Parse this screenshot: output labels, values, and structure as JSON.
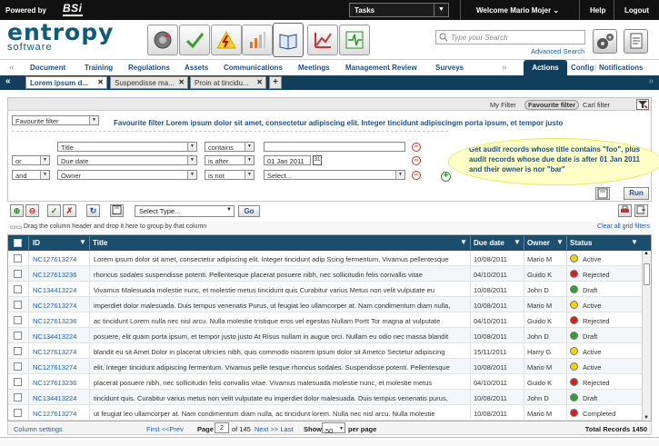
{
  "topbar": {
    "powered_by": "Powered by",
    "logo": "BSi",
    "tasks": "Tasks",
    "welcome": "Welcome  Mario Mojer",
    "help": "Help",
    "logout": "Logout"
  },
  "brand": {
    "name": "entropy",
    "sub": "software"
  },
  "toolbar_icons": [
    "gauge-icon",
    "check-icon",
    "warning-icon",
    "bar-chart-icon",
    "book-icon",
    "trend-chart-icon",
    "network-icon"
  ],
  "search": {
    "placeholder": "Type your Search",
    "advanced": "Advanced Search"
  },
  "nav": {
    "items": [
      "Document",
      "Training",
      "Regulations",
      "Assets",
      "Communications",
      "Meetings",
      "Management Review",
      "Surveys"
    ],
    "actions": "Actions",
    "config": "Config",
    "notifications": "Notifications"
  },
  "tabs": [
    {
      "label": "Lorem ipsum d..."
    },
    {
      "label": "Suspendisse ma..."
    },
    {
      "label": "Proin at tincidu..."
    }
  ],
  "filter": {
    "header_my": "My Filter",
    "header_fav": "Favourite filter",
    "header_carl": "Carl filter",
    "fav_select": "Favourite filter",
    "title": "Favourite filter Lorem ipsum dolor sit amet, consectetur adipiscing elit. Integer tincidunt adipiscingm porta ipsum, et tempor justo",
    "rows": [
      {
        "conj": "",
        "field": "Title",
        "op": "contains",
        "value": ""
      },
      {
        "conj": "or",
        "field": "Due date",
        "op": "is after",
        "value": "01 Jan 2011"
      },
      {
        "conj": "and",
        "field": "Owner",
        "op": "is not",
        "value": "Select..."
      }
    ],
    "note": "Get audit records whose title contains \"foo\", plus audit records whose due date is after 01 Jan 2011 and their owner is nor \"bar\"",
    "run": "Run"
  },
  "gridtools": {
    "type_placeholder": "Select Type...",
    "go": "Go"
  },
  "group_text": "Drag the column header and drop it here to group by that column",
  "clear_filters": "Clear all grid filters",
  "columns": {
    "id": "ID",
    "title": "Title",
    "due": "Due date",
    "owner": "Owner",
    "status": "Status"
  },
  "rows": [
    {
      "id": "NC127613274",
      "title": "Lorem ipsum dolor sit amet, consectetur adipiscing elit. Integer tincidunt adip Scing fermentum. Vivamus pellentesque",
      "due": "10/08/2011",
      "owner": "Mario M",
      "status": "Active"
    },
    {
      "id": "NC127613236",
      "title": "rhoncus sodales suspendisse potenti. Pellentesque placerat posuere nibh, nec sollicitudin felis convallis vitae",
      "due": "04/10/2011",
      "owner": "Guido K",
      "status": "Rejected"
    },
    {
      "id": "NC134413224",
      "title": "Vivamus Malesuada molestie nunc, et molestie metus tincidunt quis Curabitur  varius Metus non velit vulputate eu",
      "due": "10/08/2011",
      "owner": "John D",
      "status": "Draft"
    },
    {
      "id": "NC127613274",
      "title": "imperdiet dolor malesuada. Duis tempus venenatis Purus, ut feugiat leo ullamcorper at. Nam condimentum diam nulla,",
      "due": "10/08/2011",
      "owner": "Mario M",
      "status": "Active"
    },
    {
      "id": "NC127613236",
      "title": "ac tincidunt Lorem nulla nec nisl arcu. Nulla molestie tristique eros vel egestas Nullam Portt Tor magna at vulputate",
      "due": "04/10/2011",
      "owner": "Guido K",
      "status": "Rejected"
    },
    {
      "id": "NC134413224",
      "title": "posuere, elit quam porta ipsum, et tempor justo justo At Risus nullam in augue orci. Nullam eu odio nec massa blandit",
      "due": "10/08/2011",
      "owner": "John D",
      "status": "Draft"
    },
    {
      "id": "NC127613274",
      "title": "blandit eu sit Amet Dolor in placerat ultricies nibh, quis commodo nisorem ipsum dolor sit Ametco Sectetur adipiscing",
      "due": "15/11/2011",
      "owner": "Harry G",
      "status": "Active"
    },
    {
      "id": "NC127613274",
      "title": "elit. Integer tincidunt adipiscing fermentum. Vivamus pelle tesque rhoncus sodales. Suspendisse potenti. Pellentesque",
      "due": "10/08/2011",
      "owner": "Mario M",
      "status": "Active"
    },
    {
      "id": "NC127613236",
      "title": "placerat posuere nibh, nec sollicitudin felis convallis vitae. Vivamus malesuada molestie nunc, et molestie metus",
      "due": "04/10/2011",
      "owner": "Guido K",
      "status": "Rejected"
    },
    {
      "id": "NC134413224",
      "title": "tincidunt quis. Curabitur varius metus non velit vulputate eu imperdiet dolor malesuada. Duis tempus venenatis purus,",
      "due": "10/08/2011",
      "owner": "John D",
      "status": "Draft"
    },
    {
      "id": "NC127613274",
      "title": "ut feugiat leo ullamcorper at. Nam condimentum diam nulla, ac tincidunt lorem. Nulla nec nisl arcu. Nulla molestie",
      "due": "10/08/2011",
      "owner": "Mario M",
      "status": "Completed"
    }
  ],
  "status_colors": {
    "Active": "#f2d20c",
    "Rejected": "#d42020",
    "Draft": "#2fa12f",
    "Completed": "#d42020"
  },
  "footer": {
    "column_settings": "Column settings",
    "first_prev": "First  <<Prev",
    "page_label": "Page",
    "page": "2",
    "of": "of 145",
    "next_last": "Next >>  Last",
    "show": "Show",
    "show_value": "50",
    "per_page": "per page",
    "total": "Total Records 1450"
  }
}
